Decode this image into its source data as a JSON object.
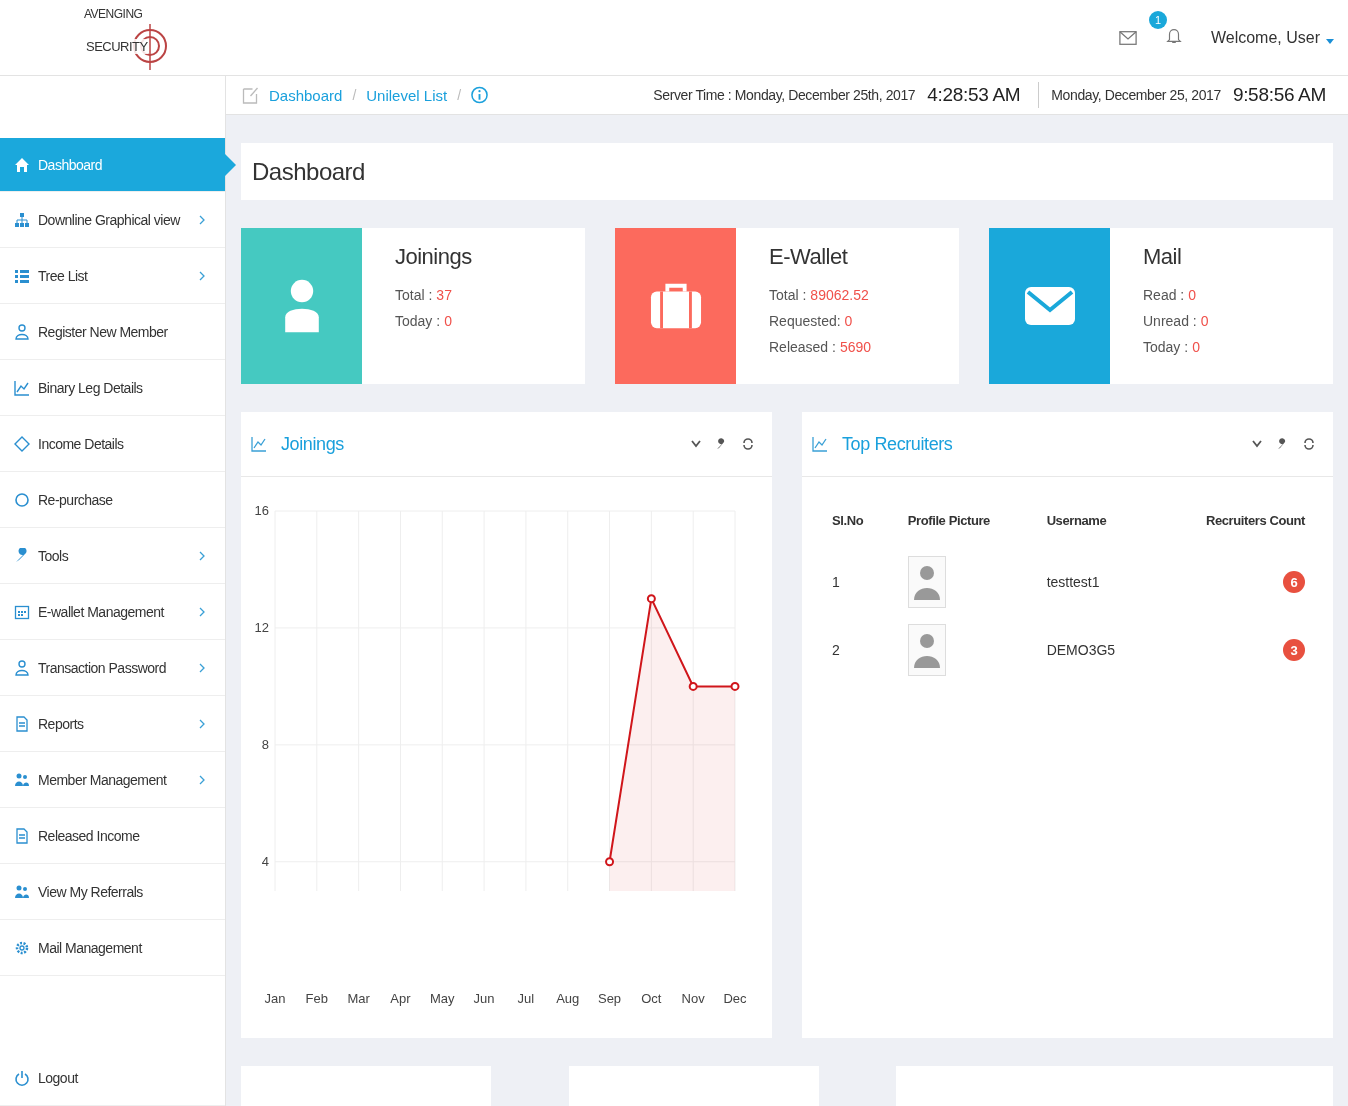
{
  "logo": {
    "line_1": "AVENGING",
    "line_2": "SECURITY"
  },
  "header": {
    "notifications": "1",
    "welcome": "Welcome, User"
  },
  "breadcrumb": [
    {
      "label": "Dashboard",
      "separator": "/"
    },
    {
      "label": "Unilevel List",
      "separator": "/"
    }
  ],
  "clock": {
    "server_label": "Server Time : Monday, December 25th, 2017",
    "server_time": "4:28:53 AM",
    "local_date": "Monday, December 25, 2017",
    "local_time": "9:58:56 AM"
  },
  "sidebar": {
    "items": [
      {
        "label": "Dashboard",
        "selected": true,
        "has_submenu": false
      },
      {
        "label": "Downline Graphical view",
        "selected": false,
        "has_submenu": true
      },
      {
        "label": "Tree List",
        "selected": false,
        "has_submenu": true
      },
      {
        "label": "Register New Member",
        "selected": false,
        "has_submenu": false
      },
      {
        "label": "Binary Leg Details",
        "selected": false,
        "has_submenu": false
      },
      {
        "label": "Income Details",
        "selected": false,
        "has_submenu": false
      },
      {
        "label": "Re-purchase",
        "selected": false,
        "has_submenu": false
      },
      {
        "label": "Tools",
        "selected": false,
        "has_submenu": true
      },
      {
        "label": "E-wallet Management",
        "selected": false,
        "has_submenu": true
      },
      {
        "label": "Transaction Password",
        "selected": false,
        "has_submenu": true
      },
      {
        "label": "Reports",
        "selected": false,
        "has_submenu": true
      },
      {
        "label": "Member Management",
        "selected": false,
        "has_submenu": true
      },
      {
        "label": "Released Income",
        "selected": false,
        "has_submenu": false
      },
      {
        "label": "View My Referrals",
        "selected": false,
        "has_submenu": false
      },
      {
        "label": "Mail Management",
        "selected": false,
        "has_submenu": false
      }
    ],
    "logout": "Logout"
  },
  "page_title": "Dashboard",
  "stats": [
    {
      "title": "Joinings",
      "color": "#45c9c1",
      "rows": [
        {
          "label": "Total :",
          "value": "37"
        },
        {
          "label": "Today :",
          "value": "0"
        }
      ]
    },
    {
      "title": "E-Wallet",
      "color": "#fc6a5d",
      "rows": [
        {
          "label": "Total :",
          "value": "89062.52"
        },
        {
          "label": "Requested:",
          "value": "0"
        },
        {
          "label": "Released :",
          "value": "5690"
        }
      ]
    },
    {
      "title": "Mail",
      "color": "#1aa8da",
      "rows": [
        {
          "label": "Read :",
          "value": "0"
        },
        {
          "label": "Unread :",
          "value": "0"
        },
        {
          "label": "Today :",
          "value": "0"
        }
      ]
    }
  ],
  "joinings_panel": {
    "title": "Joinings",
    "chart_data": {
      "type": "area",
      "categories": [
        "Jan",
        "Feb",
        "Mar",
        "Apr",
        "May",
        "Jun",
        "Jul",
        "Aug",
        "Sep",
        "Oct",
        "Nov",
        "Dec"
      ],
      "grid": true,
      "series": [
        {
          "color": "#d0161b",
          "values": [
            null,
            null,
            null,
            null,
            null,
            null,
            null,
            null,
            4,
            13,
            10,
            10
          ]
        }
      ],
      "ylim": [
        3,
        16
      ],
      "yticks": [
        4,
        8,
        12,
        16
      ]
    }
  },
  "recruiters_panel": {
    "title": "Top Recruiters",
    "columns": [
      "Sl.No",
      "Profile Picture",
      "Username",
      "Recruiters Count"
    ],
    "rows": [
      {
        "sl_no": "1",
        "username": "testtest1",
        "count": "6"
      },
      {
        "sl_no": "2",
        "username": "DEMO3G5",
        "count": "3"
      }
    ]
  }
}
